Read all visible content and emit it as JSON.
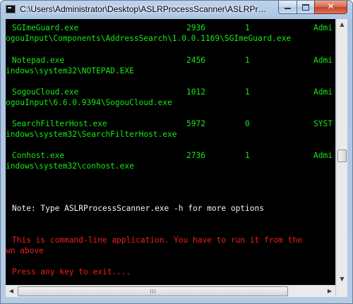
{
  "window": {
    "title": "C:\\Users\\Administrator\\Desktop\\ASLRProcessScanner\\ASLRProcessScanner.exe",
    "icon": "console-app-icon",
    "controls": {
      "minimize": "minimize",
      "maximize": "maximize",
      "close": "close"
    },
    "close_glyph": "✕"
  },
  "console": {
    "processes": [
      {
        "name": "SGImeGuard.exe",
        "pid": "2936",
        "aslr": "1",
        "user": "Admi",
        "path": "ogouInput\\Components\\AddressSearch\\1.0.0.1169\\SGImeGuard.exe"
      },
      {
        "name": "Notepad.exe",
        "pid": "2456",
        "aslr": "1",
        "user": "Admi",
        "path": "indows\\system32\\NOTEPAD.EXE"
      },
      {
        "name": "SogouCloud.exe",
        "pid": "1012",
        "aslr": "1",
        "user": "Admi",
        "path": "ogouInput\\6.6.0.9394\\SogouCloud.exe"
      },
      {
        "name": "SearchFilterHost.exe",
        "pid": "5972",
        "aslr": "0",
        "user": "SYST",
        "path": "indows\\system32\\SearchFilterHost.exe"
      },
      {
        "name": "Conhost.exe",
        "pid": "2736",
        "aslr": "1",
        "user": "Admi",
        "path": "indows\\system32\\conhost.exe"
      }
    ],
    "note": "Note: Type ASLRProcessScanner.exe -h for more options",
    "warning_line1": "This is command-line application. You have to run it from the",
    "warning_line2": "wn above",
    "prompt": "Press any key to exit....",
    "colors": {
      "background": "#000000",
      "process_text": "#16e816",
      "note_text": "#f2f2f2",
      "warning_text": "#ea1f1f"
    }
  },
  "scrollbars": {
    "up_glyph": "▲",
    "down_glyph": "▼",
    "left_glyph": "◀",
    "right_glyph": "▶"
  }
}
